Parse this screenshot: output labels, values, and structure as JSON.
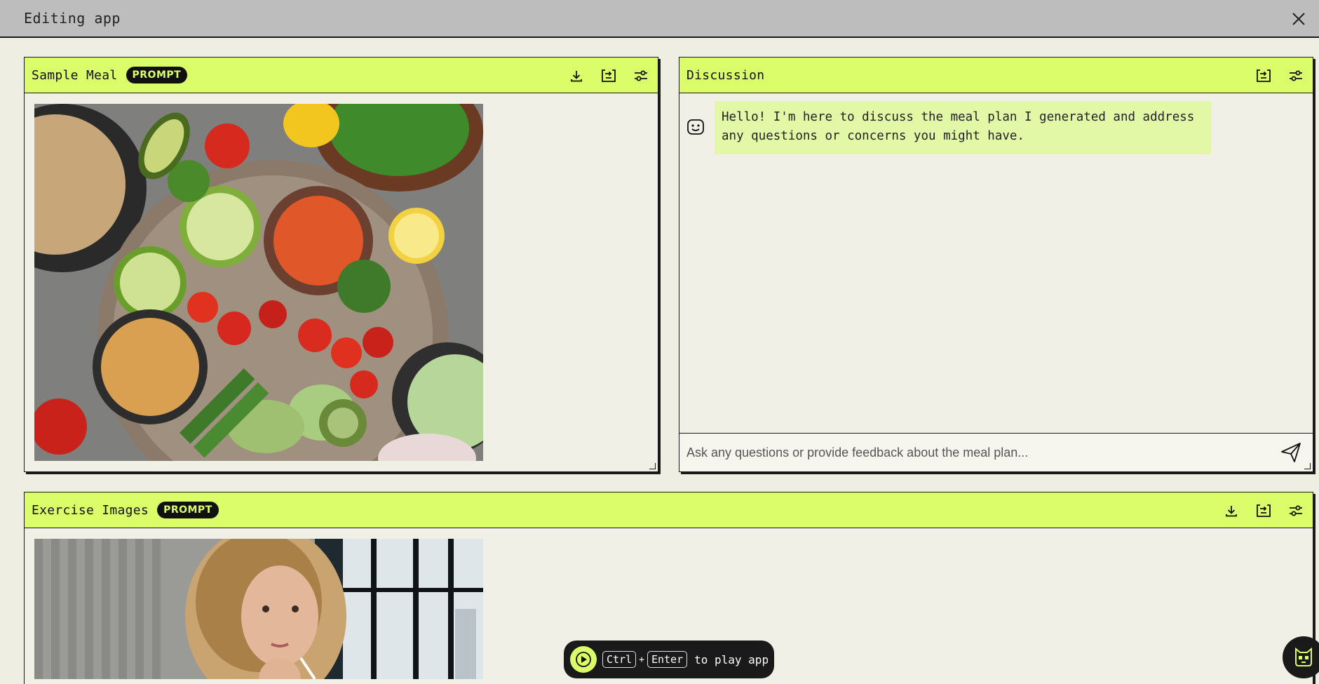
{
  "window": {
    "title": "Editing app"
  },
  "meal_panel": {
    "title": "Sample Meal",
    "badge": "PROMPT",
    "icons": [
      "download-icon",
      "output-icon",
      "settings-sliders-icon"
    ]
  },
  "discussion_panel": {
    "title": "Discussion",
    "icons": [
      "output-icon",
      "settings-sliders-icon"
    ],
    "messages": [
      {
        "sender": "bot",
        "text": "Hello! I'm here to discuss the meal plan I generated and address any questions or concerns you might have."
      }
    ],
    "input_placeholder": "Ask any questions or provide feedback about the meal plan..."
  },
  "exercise_panel": {
    "title": "Exercise Images",
    "badge": "PROMPT",
    "icons": [
      "download-icon",
      "output-icon",
      "settings-sliders-icon"
    ]
  },
  "play_bar": {
    "key1": "Ctrl",
    "plus": "+",
    "key2": "Enter",
    "text": "to play app"
  },
  "colors": {
    "accent": "#dbfd69",
    "panel_bg": "#f0f0e6",
    "titlebar_bg": "#bdbdbd",
    "bubble_bg": "#e3f8a6",
    "dark": "#1a1a1a"
  }
}
